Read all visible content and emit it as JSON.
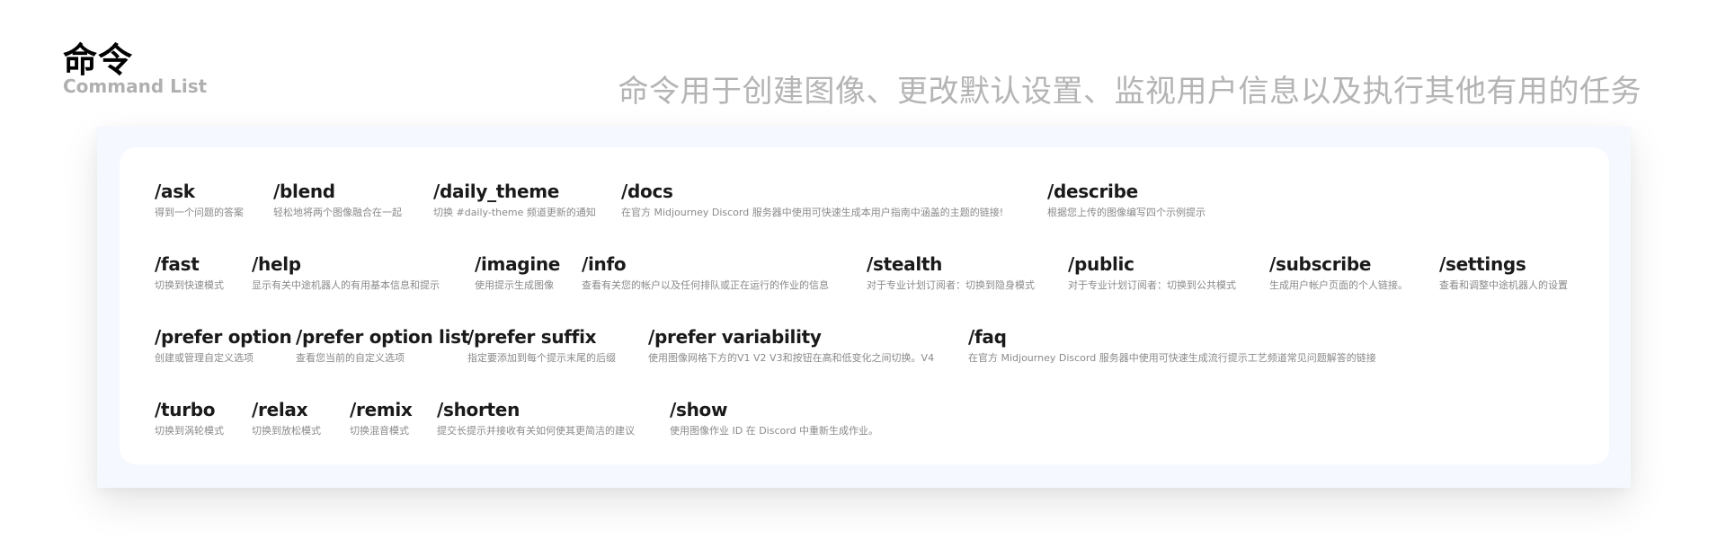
{
  "header": {
    "title": "命令",
    "subtitle_en": "Command List",
    "description": "命令用于创建图像、更改默认设置、监视用户信息以及执行其他有用的任务"
  },
  "rows": [
    [
      {
        "name": "/ask",
        "desc": "得到一个问题的答案"
      },
      {
        "name": "/blend",
        "desc": "轻松地将两个图像融合在一起"
      },
      {
        "name": "/daily_theme",
        "desc": "切换 #daily-theme 频道更新的通知"
      },
      {
        "name": "/docs",
        "desc": "在官方 Midjourney Discord 服务器中使用可快速生成本用户指南中涵盖的主题的链接!"
      },
      {
        "name": "/describe",
        "desc": "根据您上传的图像编写四个示例提示"
      }
    ],
    [
      {
        "name": "/fast",
        "desc": "切换到快速模式"
      },
      {
        "name": "/help",
        "desc": "显示有关中途机器人的有用基本信息和提示"
      },
      {
        "name": "/imagine",
        "desc": "使用提示生成图像"
      },
      {
        "name": "/info",
        "desc": "查看有关您的帐户以及任何排队或正在运行的作业的信息"
      },
      {
        "name": "/stealth",
        "desc": "对于专业计划订阅者：切换到隐身模式"
      },
      {
        "name": "/public",
        "desc": "对于专业计划订阅者：切换到公共模式"
      },
      {
        "name": "/subscribe",
        "desc": "生成用户帐户页面的个人链接。"
      },
      {
        "name": "/settings",
        "desc": "查看和调整中途机器人的设置"
      }
    ],
    [
      {
        "name": "/prefer option",
        "desc": "创建或管理自定义选项"
      },
      {
        "name": "/prefer option list",
        "desc": "查看您当前的自定义选项"
      },
      {
        "name": "/prefer suffix",
        "desc": "指定要添加到每个提示末尾的后缀"
      },
      {
        "name": "/prefer variability",
        "desc": "使用图像网格下方的V1 V2 V3和按钮在高和低变化之间切换。V4"
      },
      {
        "name": "/faq",
        "desc": "在官方 Midjourney Discord 服务器中使用可快速生成流行提示工艺频道常见问题解答的链接"
      }
    ],
    [
      {
        "name": "/turbo",
        "desc": "切换到涡轮模式"
      },
      {
        "name": "/relax",
        "desc": "切换到放松模式"
      },
      {
        "name": "/remix",
        "desc": "切换混音模式"
      },
      {
        "name": "/shorten",
        "desc": "提交长提示并接收有关如何使其更简洁的建议"
      },
      {
        "name": "/show",
        "desc": "使用图像作业 ID 在 Discord 中重新生成作业。"
      }
    ]
  ]
}
